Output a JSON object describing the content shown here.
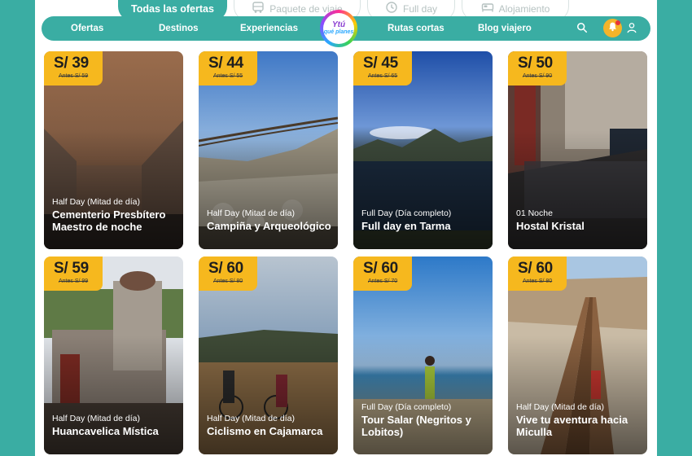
{
  "top_tabs": [
    {
      "label": "Todas las ofertas",
      "icon": "none",
      "active": true
    },
    {
      "label": "Paquete de viaje",
      "icon": "bus-icon",
      "active": false
    },
    {
      "label": "Full day",
      "icon": "clock-icon",
      "active": false
    },
    {
      "label": "Alojamiento",
      "icon": "bed-icon",
      "active": false
    }
  ],
  "nav": {
    "items": [
      "Ofertas",
      "Destinos",
      "Experiencias",
      "Rutas cortas",
      "Blog viajero"
    ],
    "logo_line1": "Ytú",
    "logo_line2": "qué planes"
  },
  "colors": {
    "brand": "#3aada3",
    "price_badge": "#f6b81e",
    "bell": "#f4b42a"
  },
  "cards": [
    {
      "price": "S/ 39",
      "old_price": "Antes S/ 59",
      "type": "Half Day (Mitad de día)",
      "name": "Cementerio Presbítero Maestro de noche"
    },
    {
      "price": "S/ 44",
      "old_price": "Antes S/ 55",
      "type": "Half Day (Mitad de día)",
      "name": "Campiña y Arqueológico"
    },
    {
      "price": "S/ 45",
      "old_price": "Antes S/ 65",
      "type": "Full Day (Día completo)",
      "name": "Full day en Tarma"
    },
    {
      "price": "S/ 50",
      "old_price": "Antes S/ 90",
      "type": "01 Noche",
      "name": "Hostal Kristal"
    },
    {
      "price": "S/ 59",
      "old_price": "Antes S/ 99",
      "type": "Half Day (Mitad de día)",
      "name": "Huancavelica Mística"
    },
    {
      "price": "S/ 60",
      "old_price": "Antes S/ 80",
      "type": "Half Day (Mitad de día)",
      "name": "Ciclismo en Cajamarca"
    },
    {
      "price": "S/ 60",
      "old_price": "Antes S/ 70",
      "type": "Full Day (Día completo)",
      "name": "Tour Salar (Negritos y Lobitos)"
    },
    {
      "price": "S/ 60",
      "old_price": "Antes S/ 80",
      "type": "Half Day (Mitad de día)",
      "name": "Vive tu aventura hacia Miculla"
    }
  ]
}
